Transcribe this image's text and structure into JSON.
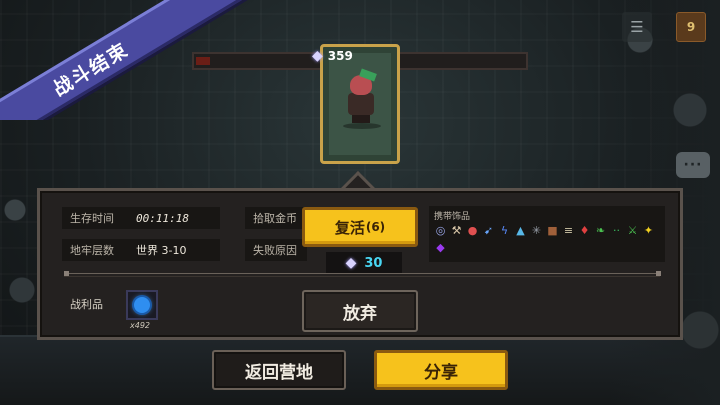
{
  "ribbon": {
    "title": "战斗结束"
  },
  "hero_card": {
    "gems": "359"
  },
  "hud": {
    "level_badge": "9"
  },
  "stats": [
    {
      "label": "生存时间",
      "value": "00:11:18"
    },
    {
      "label": "地牢层数",
      "value": "世界 3-10"
    },
    {
      "label": "拾取金币",
      "value": ""
    },
    {
      "label": "失败原因",
      "value": ""
    }
  ],
  "items": {
    "title": "携带饰品",
    "icons": [
      {
        "name": "orb-icon",
        "glyph": "◎",
        "color": "#9aa6e8"
      },
      {
        "name": "axe-icon",
        "glyph": "⚒",
        "color": "#d8c6a8"
      },
      {
        "name": "potion-red-icon",
        "glyph": "●",
        "color": "#e05050"
      },
      {
        "name": "arrow-icon",
        "glyph": "➹",
        "color": "#6aa8ff"
      },
      {
        "name": "bolt-icon",
        "glyph": "ϟ",
        "color": "#5a8cff"
      },
      {
        "name": "bell-icon",
        "glyph": "▲",
        "color": "#58b8e8"
      },
      {
        "name": "star-icon",
        "glyph": "✳",
        "color": "#9aa0aa"
      },
      {
        "name": "book-icon",
        "glyph": "■",
        "color": "#a0603a"
      },
      {
        "name": "scroll-icon",
        "glyph": "≡",
        "color": "#d0c8a8"
      },
      {
        "name": "flask-icon",
        "glyph": "♦",
        "color": "#e04040"
      },
      {
        "name": "leaf-icon",
        "glyph": "❧",
        "color": "#4ac050"
      },
      {
        "name": "dots-icon",
        "glyph": "··",
        "color": "#3ac060"
      },
      {
        "name": "dagger-icon",
        "glyph": "⚔",
        "color": "#4ac050"
      },
      {
        "name": "sparkle-icon",
        "glyph": "✦",
        "color": "#f0d020"
      },
      {
        "name": "amethyst-icon",
        "glyph": "◆",
        "color": "#9a3af0"
      }
    ]
  },
  "revive": {
    "label": "复活",
    "count": "(6)",
    "cost": "30"
  },
  "loot": {
    "label": "战利品",
    "count": "x492"
  },
  "buttons": {
    "give_up": "放弃",
    "return_camp": "返回营地",
    "share": "分享"
  }
}
